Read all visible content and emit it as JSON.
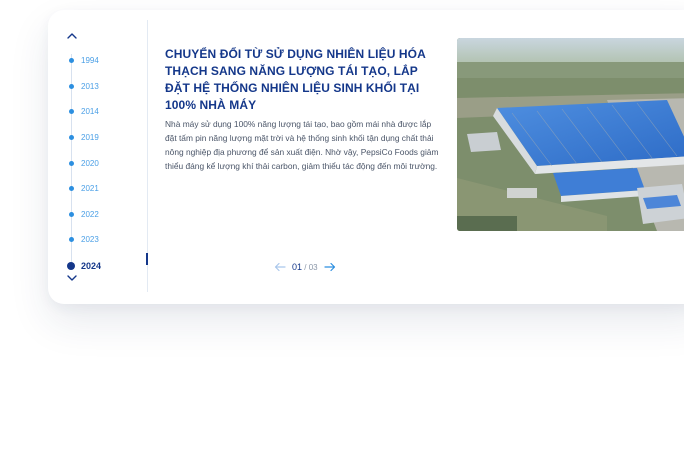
{
  "timeline": {
    "years": [
      "1994",
      "2013",
      "2014",
      "2019",
      "2020",
      "2021",
      "2022",
      "2023",
      "2024"
    ],
    "active_year": "2024"
  },
  "milestone": {
    "title": "CHUYỂN ĐỔI TỪ SỬ DỤNG NHIÊN LIỆU HÓA THẠCH SANG NĂNG LƯỢNG TÁI TẠO, LẮP ĐẶT HỆ THỐNG NHIÊN LIỆU SINH KHỐI TẠI 100% NHÀ MÁY",
    "description": "Nhà máy sử dụng 100% năng lượng tái tạo, bao gồm mái nhà được lắp đặt tấm pin năng lượng mặt trời và hệ thống sinh khối tận dụng chất thải nông nghiệp địa phương để sản xuất điện. Nhờ vậy, PepsiCo Foods giảm thiểu đáng kể lượng khí thải carbon, giảm thiểu tác động đến môi trường."
  },
  "pager": {
    "current": "01",
    "separator": "/",
    "total": "03"
  },
  "photo": {
    "icon": "factory-solar-roof-photo"
  },
  "colors": {
    "navy": "#14378a",
    "accent_blue": "#2c8fe0",
    "text_gray": "#4a5568"
  }
}
